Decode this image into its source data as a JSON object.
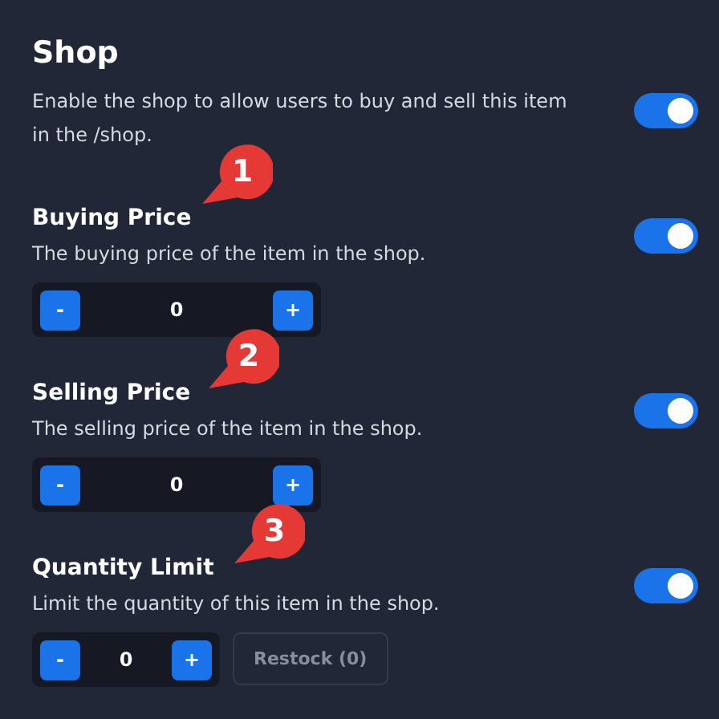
{
  "shop": {
    "title": "Shop",
    "description": "Enable the shop to allow users to buy and sell this item in the /shop.",
    "enabled": true
  },
  "settings": [
    {
      "title": "Buying Price",
      "description": "The buying price of the item in the shop.",
      "enabled": true,
      "callout": "1",
      "stepper": {
        "minus": "-",
        "value": "0",
        "plus": "+"
      }
    },
    {
      "title": "Selling Price",
      "description": "The selling price of the item in the shop.",
      "enabled": true,
      "callout": "2",
      "stepper": {
        "minus": "-",
        "value": "0",
        "plus": "+"
      }
    },
    {
      "title": "Quantity Limit",
      "description": "Limit the quantity of this item in the shop.",
      "enabled": true,
      "callout": "3",
      "stepper": {
        "minus": "-",
        "value": "0",
        "plus": "+"
      },
      "restock": {
        "label": "Restock (0)",
        "disabled": true
      }
    }
  ]
}
